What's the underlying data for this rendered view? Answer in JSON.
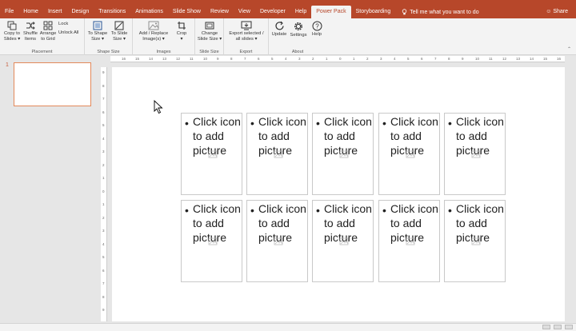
{
  "tabs": [
    "File",
    "Home",
    "Insert",
    "Design",
    "Transitions",
    "Animations",
    "Slide Show",
    "Review",
    "View",
    "Developer",
    "Help",
    "Power Pack",
    "Storyboarding"
  ],
  "active_tab": "Power Pack",
  "tell_me": "Tell me what you want to do",
  "share": "Share",
  "ribbon": {
    "placement": {
      "label": "Placement",
      "copy_to_slides": [
        "Copy to",
        "Slides"
      ],
      "shuffle_items": [
        "Shuffle",
        "Items"
      ],
      "arrange_to_grid": [
        "Arrange",
        "to Grid"
      ],
      "lock": "Lock",
      "unlock_all": "Unlock All"
    },
    "shape_size": {
      "label": "Shape Size",
      "to_shape_size": [
        "To Shape",
        "Size"
      ],
      "to_slide_size": [
        "To Slide",
        "Size"
      ]
    },
    "images": {
      "label": "Images",
      "add_replace": [
        "Add / Replace",
        "Image(s)"
      ],
      "crop": "Crop"
    },
    "slide_size": {
      "label": "Slide Size",
      "change_slide_size": [
        "Change",
        "Slide Size"
      ]
    },
    "export": {
      "label": "Export",
      "export_selected": [
        "Export selected /",
        "all slides"
      ]
    },
    "about": {
      "label": "About",
      "update": "Update",
      "settings": "Settings",
      "help": "Help"
    }
  },
  "slide_number": "1",
  "ruler_h": [
    "16",
    "15",
    "14",
    "13",
    "12",
    "11",
    "10",
    "9",
    "8",
    "7",
    "6",
    "5",
    "4",
    "3",
    "2",
    "1",
    "0",
    "1",
    "2",
    "3",
    "4",
    "5",
    "6",
    "7",
    "8",
    "9",
    "10",
    "11",
    "12",
    "13",
    "14",
    "15",
    "16"
  ],
  "ruler_v": [
    "9",
    "8",
    "7",
    "6",
    "5",
    "4",
    "3",
    "2",
    "1",
    "0",
    "1",
    "2",
    "3",
    "4",
    "5",
    "6",
    "7",
    "8",
    "9"
  ],
  "placeholders": [
    "Click icon to add picture",
    "Click icon to add picture",
    "Click icon to add picture",
    "Click icon to add picture",
    "Click icon to add picture",
    "Click icon to add picture",
    "Click icon to add picture",
    "Click icon to add picture",
    "Click icon to add picture",
    "Click icon to add picture"
  ],
  "colors": {
    "accent": "#b7472a",
    "ribbon_bg": "#f3f3f3",
    "canvas_bg": "#e6e6e6"
  }
}
